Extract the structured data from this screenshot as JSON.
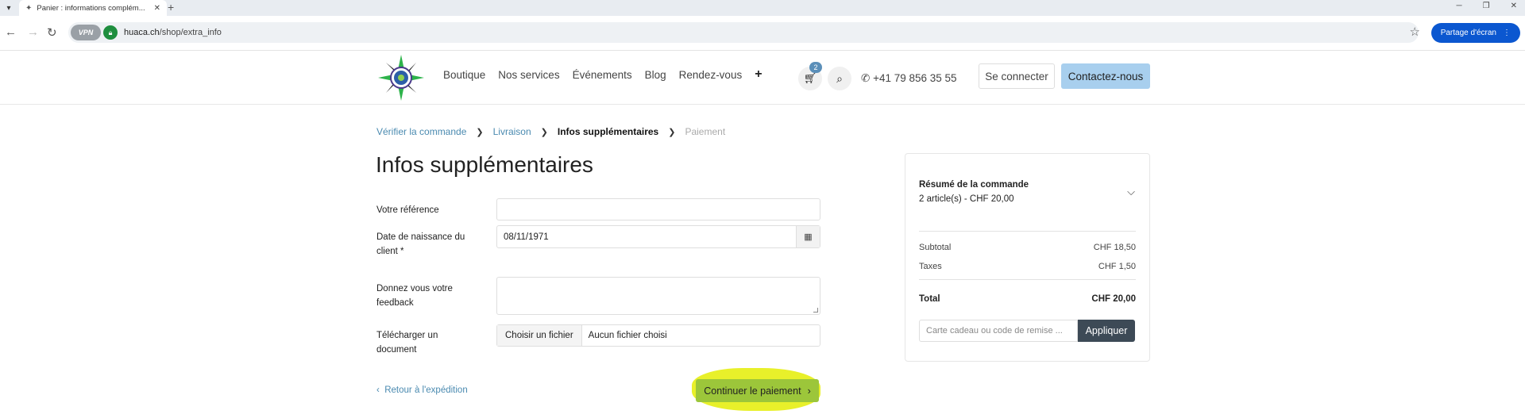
{
  "browser": {
    "tab_title": "Panier : informations complém...",
    "url_domain": "huaca.ch",
    "url_path": "/shop/extra_info",
    "vpn_label": "VPN",
    "share_label": "Partage d'écran"
  },
  "header": {
    "nav": [
      "Boutique",
      "Nos services",
      "Événements",
      "Blog",
      "Rendez-vous"
    ],
    "nav_plus": "+",
    "cart_count": "2",
    "phone": "+41 79 856 35 55",
    "login": "Se connecter",
    "contact": "Contactez-nous"
  },
  "breadcrumb": {
    "step1": "Vérifier la commande",
    "step2": "Livraison",
    "step3": "Infos supplémentaires",
    "step4": "Paiement"
  },
  "page_title": "Infos supplémentaires",
  "form": {
    "reference_label": "Votre référence",
    "reference_value": "",
    "birthdate_label": "Date de naissance du client *",
    "birthdate_value": "08/11/1971",
    "feedback_label": "Donnez vous votre feedback",
    "feedback_value": "",
    "upload_label": "Télécharger un document",
    "upload_button": "Choisir un fichier",
    "upload_status": "Aucun fichier choisi"
  },
  "actions": {
    "back": "Retour à l'expédition",
    "continue": "Continuer le paiement"
  },
  "summary": {
    "title": "Résumé de la commande",
    "subtitle": "2 article(s) -  CHF 20,00",
    "subtotal_label": "Subtotal",
    "subtotal_value": "CHF 18,50",
    "taxes_label": "Taxes",
    "taxes_value": "CHF 1,50",
    "total_label": "Total",
    "total_value": "CHF 20,00",
    "promo_placeholder": "Carte cadeau ou code de remise ...",
    "promo_button": "Appliquer"
  },
  "colors": {
    "link": "#4a8ab0",
    "continue_button": "#9cc63a",
    "highlight": "#e8f02a",
    "contact_button": "#a8cfee",
    "apply_button": "#3d4a56"
  }
}
